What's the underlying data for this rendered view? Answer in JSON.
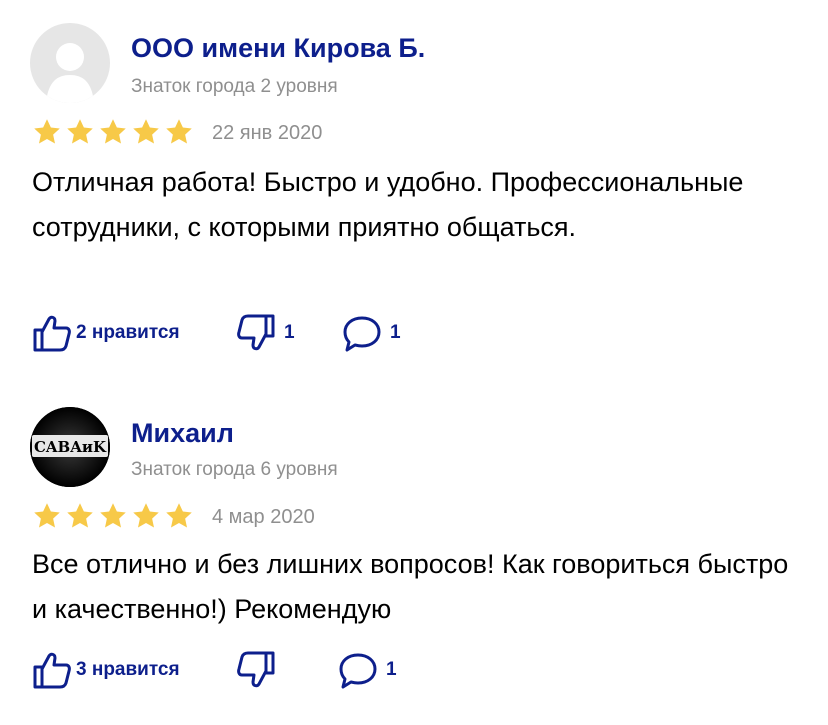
{
  "reviews": [
    {
      "author": "ООО имени Кирова Б.",
      "level": "Знаток города 2 уровня",
      "rating": 5,
      "date": "22 янв 2020",
      "text": "Отличная работа! Быстро и удобно. Профессиональные сотрудники, с которыми приятно общаться.",
      "likes_label": "2 нравится",
      "dislikes": "1",
      "comments": "1",
      "avatar_icon": "user-silhouette-icon"
    },
    {
      "author": "Михаил",
      "level": "Знаток города 6 уровня",
      "rating": 5,
      "date": "4 мар 2020",
      "text": "Все отлично и без лишних вопросов! Как говориться быстро и качественно!) Рекомендую",
      "likes_label": "3 нравится",
      "dislikes": "",
      "comments": "1",
      "avatar_logo_text": "CABAиK"
    }
  ],
  "colors": {
    "accent": "#0d1f8c",
    "star": "#f7c948",
    "muted": "#8f8f8f"
  }
}
